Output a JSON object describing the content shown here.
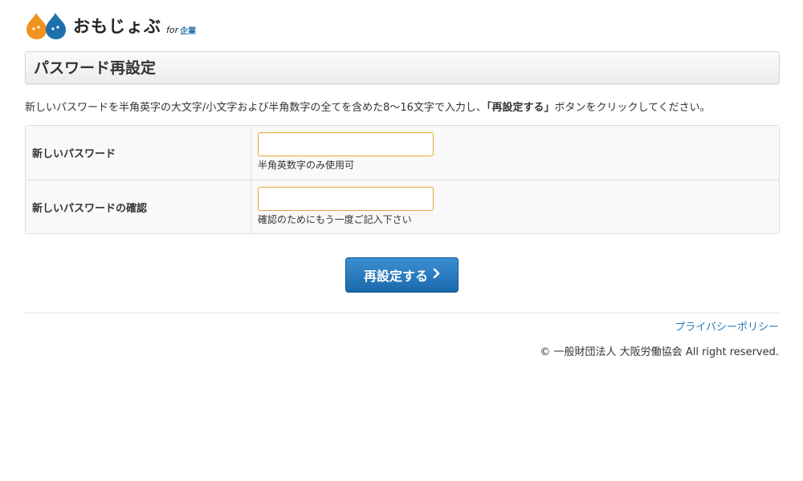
{
  "brand": {
    "name": "おもじょぶ",
    "for_label": "for",
    "corp_label": "企業",
    "colors": {
      "orange": "#f0931f",
      "blue": "#1e6fae"
    }
  },
  "page": {
    "title": "パスワード再設定",
    "intro_prefix": "新しいパスワードを半角英字の大文字/小文字および半角数字の全てを含めた8〜16文字で入力し、",
    "intro_emphasis": "「再設定する」",
    "intro_suffix": "ボタンをクリックしてください。"
  },
  "form": {
    "rows": [
      {
        "label": "新しいパスワード",
        "value": "",
        "hint": "半角英数字のみ使用可"
      },
      {
        "label": "新しいパスワードの確認",
        "value": "",
        "hint": "確認のためにもう一度ご記入下さい"
      }
    ],
    "submit_label": "再設定する",
    "submit_icon": "chevron-right-icon",
    "input_border_color": "#e8a33a"
  },
  "footer": {
    "privacy_link": "プライバシーポリシー",
    "copyright": "© 一般財団法人 大阪労働協会 All right reserved."
  }
}
